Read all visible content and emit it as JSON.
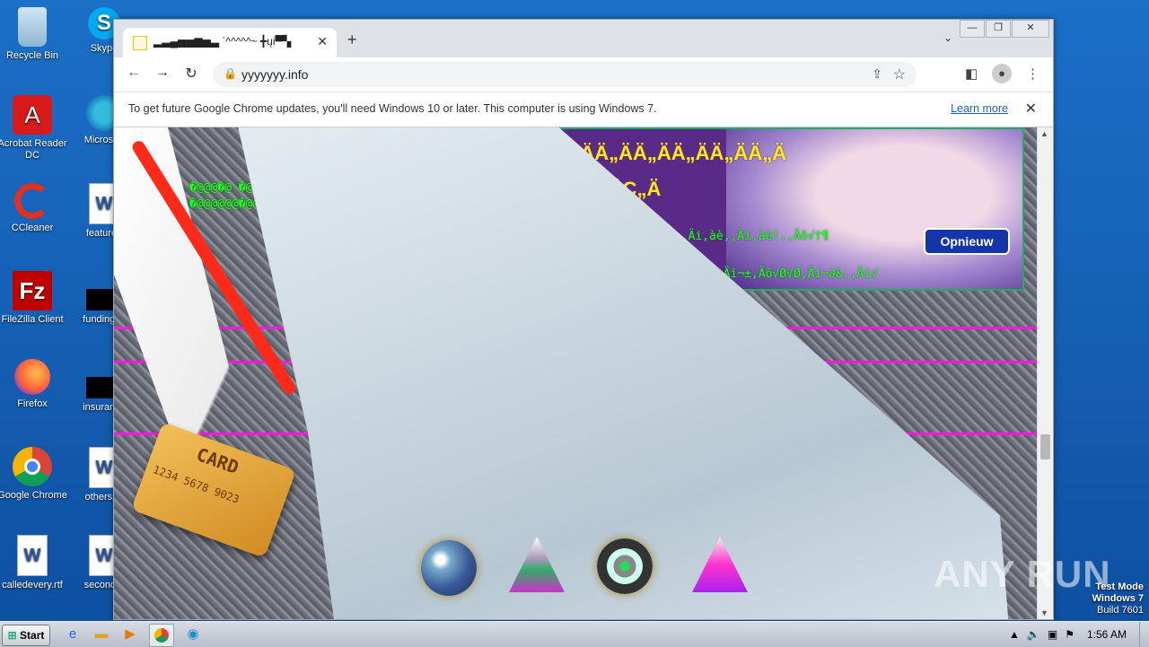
{
  "desktop": {
    "icons": [
      {
        "label": "Recycle Bin",
        "icon": "recycle-bin-icon"
      },
      {
        "label": "Skype",
        "icon": "skype-icon"
      },
      {
        "label": "Acrobat Reader DC",
        "icon": "acrobat-icon"
      },
      {
        "label": "Microsoft",
        "icon": "edge-icon"
      },
      {
        "label": "CCleaner",
        "icon": "ccleaner-icon"
      },
      {
        "label": "featured",
        "icon": "word-doc-icon"
      },
      {
        "label": "FileZilla Client",
        "icon": "filezilla-icon"
      },
      {
        "label": "fundingse",
        "icon": "black-file-icon"
      },
      {
        "label": "Firefox",
        "icon": "firefox-icon"
      },
      {
        "label": "insurance",
        "icon": "black-file-icon"
      },
      {
        "label": "Google Chrome",
        "icon": "chrome-icon"
      },
      {
        "label": "otherspo",
        "icon": "word-doc-icon"
      },
      {
        "label": "calledevery.rtf",
        "icon": "word-doc-icon"
      },
      {
        "label": "secondto",
        "icon": "word-doc-icon"
      }
    ]
  },
  "browser": {
    "tab_title": "▂▃▄▅▅▆▅▃ `^^^^^~ ╋ųi▀▚",
    "new_tab": "+",
    "url": "yyyyyyy.info",
    "infobar": {
      "message": "To get future Google Chrome updates, you'll need Windows 10 or later. This computer is using Windows 7.",
      "learn_more": "Learn more"
    }
  },
  "page": {
    "yellow_line": "„ÄÄ„ÄÄ„ÄÄ„ÄÄ„ÄÄ„ÄÄ„ÄÄ„ÄÄ„Ä",
    "yellow_line2": "„Ä„ÄÄ„ÄÇ„Ä",
    "green_line1": "�@@@�@ �@ �@ �@ �@ �@ �@/ �///||||||;.. |||.@@",
    "green_line2": "�@@@@@@�@@ �@@@@@@@@@@@@@@@@@@@@M,||||||@@@@@@|||||",
    "green_line3": "„Ä∂√∏.,Äi,äè.,Äi,àè,,Äi,àè!.,Äõ√†¶",
    "green_line4": ",Äi¬®.,Äi√Ö,Äi,à˘V,Äi¬±,Äõ√Ø√Ø,Äi¬∂&.,Äi√",
    "button_label": "Opnieuw",
    "card_text": "CARD",
    "card_number": "1234 5678 9023"
  },
  "watermark": "ANY RUN",
  "testmode": {
    "line1": "Test Mode",
    "line2": "Windows 7",
    "line3": "Build 7601"
  },
  "taskbar": {
    "start": "Start",
    "clock": "1:56 AM"
  }
}
